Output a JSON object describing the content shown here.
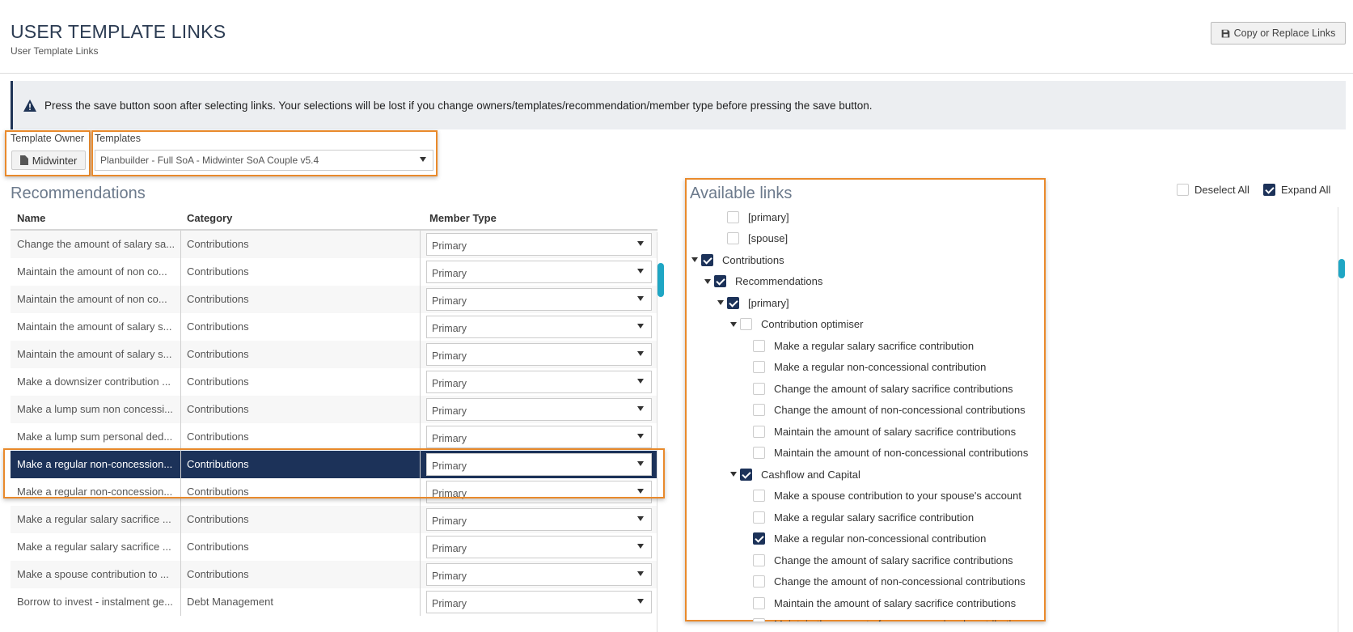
{
  "header": {
    "title": "USER TEMPLATE LINKS",
    "subtitle": "User Template Links",
    "copy_button": "Copy or Replace Links"
  },
  "alert": {
    "text": "Press the save button soon after selecting links. Your selections will be lost if you change owners/templates/recommendation/member type before pressing the save button."
  },
  "owner": {
    "label": "Template Owner",
    "value": "Midwinter"
  },
  "templates": {
    "label": "Templates",
    "value": "Planbuilder - Full SoA - Midwinter SoA Couple v5.4"
  },
  "recommendations": {
    "title": "Recommendations",
    "columns": [
      "Name",
      "Category",
      "Member Type"
    ],
    "rows": [
      {
        "name": "Change the amount of salary sa...",
        "category": "Contributions",
        "member_type": "Primary"
      },
      {
        "name": "Maintain the amount of non co...",
        "category": "Contributions",
        "member_type": "Primary"
      },
      {
        "name": "Maintain the amount of non co...",
        "category": "Contributions",
        "member_type": "Primary"
      },
      {
        "name": "Maintain the amount of salary s...",
        "category": "Contributions",
        "member_type": "Primary"
      },
      {
        "name": "Maintain the amount of salary s...",
        "category": "Contributions",
        "member_type": "Primary"
      },
      {
        "name": "Make a downsizer contribution ...",
        "category": "Contributions",
        "member_type": "Primary"
      },
      {
        "name": "Make a lump sum non concessi...",
        "category": "Contributions",
        "member_type": "Primary"
      },
      {
        "name": "Make a lump sum personal ded...",
        "category": "Contributions",
        "member_type": "Primary"
      },
      {
        "name": "Make a regular non-concession...",
        "category": "Contributions",
        "member_type": "Primary",
        "selected": true
      },
      {
        "name": "Make a regular non-concession...",
        "category": "Contributions",
        "member_type": "Primary"
      },
      {
        "name": "Make a regular salary sacrifice ...",
        "category": "Contributions",
        "member_type": "Primary"
      },
      {
        "name": "Make a regular salary sacrifice ...",
        "category": "Contributions",
        "member_type": "Primary"
      },
      {
        "name": "Make a spouse contribution to ...",
        "category": "Contributions",
        "member_type": "Primary"
      },
      {
        "name": "Borrow to invest - instalment ge...",
        "category": "Debt Management",
        "member_type": "Primary"
      }
    ]
  },
  "available_links": {
    "title": "Available links",
    "deselect_all": "Deselect All",
    "expand_all": "Expand All",
    "expand_all_checked": true,
    "tree": [
      {
        "label": "[primary]",
        "level": 3,
        "checked": false,
        "toggle": false
      },
      {
        "label": "[spouse]",
        "level": 3,
        "checked": false,
        "toggle": false
      },
      {
        "label": "Contributions",
        "level": 1,
        "checked": true,
        "toggle": true
      },
      {
        "label": "Recommendations",
        "level": 2,
        "checked": true,
        "toggle": true
      },
      {
        "label": "[primary]",
        "level": 3,
        "checked": true,
        "toggle": true
      },
      {
        "label": "Contribution optimiser",
        "level": 4,
        "checked": false,
        "toggle": true
      },
      {
        "label": "Make a regular salary sacrifice contribution",
        "level": 5,
        "checked": false,
        "toggle": false
      },
      {
        "label": "Make a regular non-concessional contribution",
        "level": 5,
        "checked": false,
        "toggle": false
      },
      {
        "label": "Change the amount of salary sacrifice contributions",
        "level": 5,
        "checked": false,
        "toggle": false
      },
      {
        "label": "Change the amount of non-concessional contributions",
        "level": 5,
        "checked": false,
        "toggle": false
      },
      {
        "label": "Maintain the amount of salary sacrifice contributions",
        "level": 5,
        "checked": false,
        "toggle": false
      },
      {
        "label": "Maintain the amount of non-concessional contributions",
        "level": 5,
        "checked": false,
        "toggle": false
      },
      {
        "label": "Cashflow and Capital",
        "level": 4,
        "checked": true,
        "toggle": true
      },
      {
        "label": "Make a spouse contribution to your spouse's account",
        "level": 5,
        "checked": false,
        "toggle": false
      },
      {
        "label": "Make a regular salary sacrifice contribution",
        "level": 5,
        "checked": false,
        "toggle": false
      },
      {
        "label": "Make a regular non-concessional contribution",
        "level": 5,
        "checked": true,
        "toggle": false
      },
      {
        "label": "Change the amount of salary sacrifice contributions",
        "level": 5,
        "checked": false,
        "toggle": false
      },
      {
        "label": "Change the amount of non-concessional contributions",
        "level": 5,
        "checked": false,
        "toggle": false
      },
      {
        "label": "Maintain the amount of salary sacrifice contributions",
        "level": 5,
        "checked": false,
        "toggle": false
      },
      {
        "label": "Maintain the amount of non-concessional contributions",
        "level": 5,
        "checked": false,
        "toggle": false
      }
    ]
  },
  "colors": {
    "accent_navy": "#1c3259",
    "highlight_orange": "#e98a2c",
    "scroll_teal": "#1fa6c4"
  }
}
